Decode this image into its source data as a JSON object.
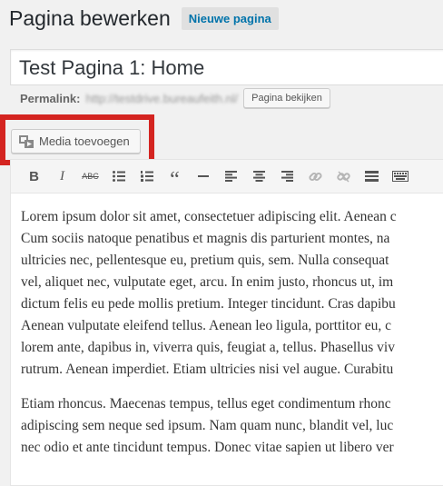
{
  "header": {
    "title": "Pagina bewerken",
    "new_page_label": "Nieuwe pagina"
  },
  "title_field": {
    "value": "Test Pagina 1: Home"
  },
  "permalink": {
    "label": "Permalink:",
    "url": "http://testdrive.bureaufeith.nl/",
    "view_button_label": "Pagina bekijken"
  },
  "media": {
    "button_label": "Media toevoegen",
    "highlight_color": "#d42420"
  },
  "toolbar": {
    "buttons": [
      {
        "name": "bold",
        "glyph": "B"
      },
      {
        "name": "italic",
        "glyph": "I"
      },
      {
        "name": "strikethrough",
        "glyph": "ABC"
      },
      {
        "name": "bullet-list",
        "glyph": "list"
      },
      {
        "name": "numbered-list",
        "glyph": "olist"
      },
      {
        "name": "blockquote",
        "glyph": "“"
      },
      {
        "name": "horizontal-line",
        "glyph": "hr"
      },
      {
        "name": "align-left",
        "glyph": "al"
      },
      {
        "name": "align-center",
        "glyph": "ac"
      },
      {
        "name": "align-right",
        "glyph": "ar"
      },
      {
        "name": "insert-link",
        "glyph": "link"
      },
      {
        "name": "remove-link",
        "glyph": "unlink"
      },
      {
        "name": "read-more",
        "glyph": "more"
      },
      {
        "name": "toolbar-toggle",
        "glyph": "kb"
      }
    ]
  },
  "content": {
    "paragraphs": [
      [
        "Lorem ipsum dolor sit amet, consectetuer adipiscing elit. Aenean c",
        "Cum sociis natoque penatibus et magnis dis parturient montes, na",
        "ultricies nec, pellentesque eu, pretium quis, sem. Nulla consequat",
        "vel, aliquet nec, vulputate eget, arcu. In enim justo, rhoncus ut, im",
        "dictum felis eu pede mollis pretium. Integer tincidunt. Cras dapibu",
        "Aenean vulputate eleifend tellus. Aenean leo ligula, porttitor eu, c",
        "lorem ante, dapibus in, viverra quis, feugiat a, tellus. Phasellus viv",
        "rutrum. Aenean imperdiet. Etiam ultricies nisi vel augue. Curabitu"
      ],
      [
        "Etiam rhoncus. Maecenas tempus, tellus eget condimentum rhonc",
        "adipiscing sem neque sed ipsum. Nam quam nunc, blandit vel, luc",
        "nec odio et ante tincidunt tempus. Donec vitae sapien ut libero ver"
      ]
    ]
  }
}
